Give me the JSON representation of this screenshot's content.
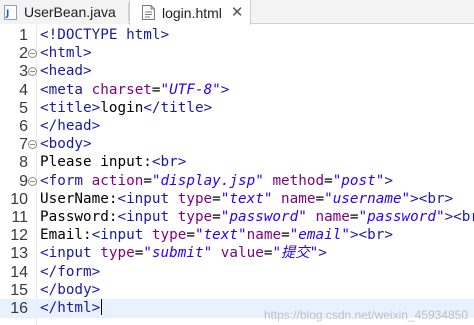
{
  "tabs": [
    {
      "label": "UserBean.java",
      "icon": "java-file-icon",
      "active": false
    },
    {
      "label": "login.html",
      "icon": "html-file-icon",
      "active": true,
      "close": "✕"
    }
  ],
  "editor": {
    "lines": [
      {
        "n": "1",
        "fold": false,
        "parts": [
          [
            "t",
            "<!DOCTYPE html>"
          ]
        ]
      },
      {
        "n": "2",
        "fold": true,
        "parts": [
          [
            "t",
            "<html>"
          ]
        ]
      },
      {
        "n": "3",
        "fold": true,
        "parts": [
          [
            "t",
            "<head>"
          ]
        ]
      },
      {
        "n": "4",
        "fold": false,
        "parts": [
          [
            "t",
            "<meta "
          ],
          [
            "a",
            "charset"
          ],
          [
            "tx",
            "="
          ],
          [
            "v",
            "\"UTF-8\""
          ],
          [
            "t",
            ">"
          ]
        ]
      },
      {
        "n": "5",
        "fold": false,
        "parts": [
          [
            "t",
            "<title>"
          ],
          [
            "tx",
            "login"
          ],
          [
            "t",
            "</title>"
          ]
        ]
      },
      {
        "n": "6",
        "fold": false,
        "parts": [
          [
            "t",
            "</head>"
          ]
        ]
      },
      {
        "n": "7",
        "fold": true,
        "parts": [
          [
            "t",
            "<body>"
          ]
        ]
      },
      {
        "n": "8",
        "fold": false,
        "parts": [
          [
            "tx",
            "Please input:"
          ],
          [
            "t",
            "<br>"
          ]
        ]
      },
      {
        "n": "9",
        "fold": true,
        "parts": [
          [
            "t",
            "<form "
          ],
          [
            "a",
            "action"
          ],
          [
            "tx",
            "="
          ],
          [
            "v",
            "\"display.jsp\""
          ],
          [
            "tx",
            " "
          ],
          [
            "a",
            "method"
          ],
          [
            "tx",
            "="
          ],
          [
            "v",
            "\"post\""
          ],
          [
            "t",
            ">"
          ]
        ]
      },
      {
        "n": "10",
        "fold": false,
        "parts": [
          [
            "tx",
            "UserName:"
          ],
          [
            "t",
            "<input "
          ],
          [
            "a",
            "type"
          ],
          [
            "tx",
            "="
          ],
          [
            "v",
            "\"text\""
          ],
          [
            "tx",
            " "
          ],
          [
            "a",
            "name"
          ],
          [
            "tx",
            "="
          ],
          [
            "v",
            "\"username\""
          ],
          [
            "t",
            "><br>"
          ]
        ]
      },
      {
        "n": "11",
        "fold": false,
        "parts": [
          [
            "tx",
            "Password:"
          ],
          [
            "t",
            "<input "
          ],
          [
            "a",
            "type"
          ],
          [
            "tx",
            "="
          ],
          [
            "v",
            "\"password\""
          ],
          [
            "tx",
            " "
          ],
          [
            "a",
            "name"
          ],
          [
            "tx",
            "="
          ],
          [
            "v",
            "\"password\""
          ],
          [
            "t",
            "><br>"
          ]
        ]
      },
      {
        "n": "12",
        "fold": false,
        "parts": [
          [
            "tx",
            "Email:"
          ],
          [
            "t",
            "<input "
          ],
          [
            "a",
            "type"
          ],
          [
            "tx",
            "="
          ],
          [
            "v",
            "\"text\""
          ],
          [
            "a",
            "name"
          ],
          [
            "tx",
            "="
          ],
          [
            "v",
            "\"email\""
          ],
          [
            "t",
            "><br>"
          ]
        ]
      },
      {
        "n": "13",
        "fold": false,
        "parts": [
          [
            "t",
            "<input "
          ],
          [
            "a",
            "type"
          ],
          [
            "tx",
            "="
          ],
          [
            "v",
            "\"submit\""
          ],
          [
            "tx",
            " "
          ],
          [
            "a",
            "value"
          ],
          [
            "tx",
            "="
          ],
          [
            "v",
            "\"提交\""
          ],
          [
            "t",
            ">"
          ]
        ]
      },
      {
        "n": "14",
        "fold": false,
        "parts": [
          [
            "t",
            "</form>"
          ]
        ]
      },
      {
        "n": "15",
        "fold": false,
        "parts": [
          [
            "t",
            "</body>"
          ]
        ]
      },
      {
        "n": "16",
        "fold": false,
        "cursor": true,
        "parts": [
          [
            "t",
            "</html>"
          ]
        ]
      }
    ]
  },
  "watermark": "https://blog.csdn.net/weixin_45934850",
  "colors": {
    "tag": "#1a1aa6",
    "attribute": "#7f007f",
    "value": "#2a00ff",
    "text": "#000000",
    "current_line": "#e8f2fe"
  }
}
